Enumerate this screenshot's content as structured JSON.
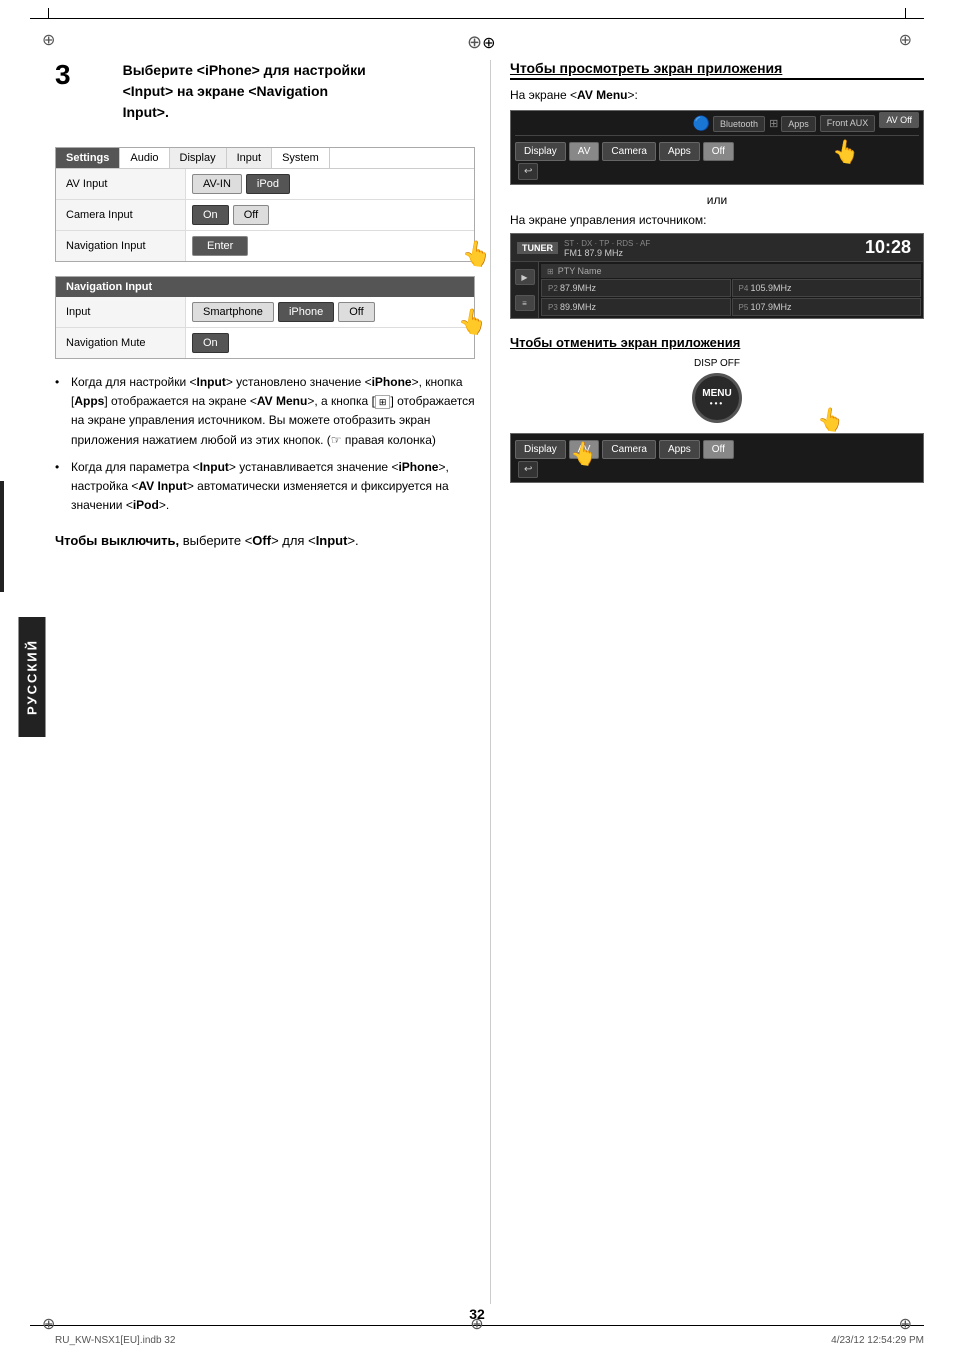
{
  "page": {
    "number": "32",
    "footer_file": "RU_KW-NSX1[EU].indb  32",
    "footer_date": "4/23/12   12:54:29 PM"
  },
  "sidebar": {
    "label": "РУССКИЙ"
  },
  "step3": {
    "number": "3",
    "text_line1": "Выберите <iPhone> для настройки",
    "text_line2": "<Input> на экране <Navigation",
    "text_line3": "Input>.",
    "settings_table": {
      "header": [
        "Settings",
        "Audio",
        "Display",
        "Input",
        "System"
      ],
      "rows": [
        {
          "label": "AV Input",
          "values": [
            "AV-IN",
            "iPod"
          ]
        },
        {
          "label": "Camera Input",
          "values": [
            "On",
            "Off"
          ]
        },
        {
          "label": "Navigation Input",
          "values": [
            "Enter"
          ]
        }
      ]
    },
    "nav_input_table": {
      "header": "Navigation Input",
      "rows": [
        {
          "label": "Input",
          "values": [
            "Smartphone",
            "iPhone",
            "Off"
          ]
        },
        {
          "label": "Navigation Mute",
          "values": [
            "On"
          ]
        }
      ]
    },
    "bullets": [
      "Когда для настройки <Input> установлено значение <iPhone>, кнопка [Apps] отображается на экране <AV Menu>, а кнопка [   ] отображается на экране управления источником. Вы можете отобразить экран приложения нажатием любой из этих кнопок. (☞ правая колонка)",
      "Когда для параметра <Input> устанавливается значение <iPhone>, настройка <AV Input> автоматически изменяется и фиксируется на значении <iPod>."
    ],
    "off_text": "Чтобы выключить, выберите <Off> для <Input>."
  },
  "right_col": {
    "view_section": {
      "title": "Чтобы просмотреть экран приложения",
      "subtitle": "На экране <AV Menu>:",
      "av_menu": {
        "top_buttons": [
          "Bluetooth",
          "Apps",
          "Front AUX",
          "AV Off"
        ],
        "bottom_buttons": [
          "Display",
          "AV",
          "Camera",
          "Apps",
          "Off"
        ]
      },
      "or_text": "или",
      "source_text": "На экране управления источником:",
      "tuner": {
        "label": "TUNER",
        "freq_info": "FM1  87.9 MHz",
        "time": "10:28",
        "pty_name": "PTY Name",
        "stations": [
          {
            "preset": "P2",
            "freq": "87.9MHz"
          },
          {
            "preset": "P4",
            "freq": "105.9MHz"
          },
          {
            "preset": "P3",
            "freq": "89.9MHz"
          },
          {
            "preset": "P5",
            "freq": "107.9MHz"
          }
        ]
      }
    },
    "cancel_section": {
      "title": "Чтобы отменить экран приложения",
      "disp_off": "DISP OFF",
      "menu_label": "MENU",
      "dots": "•••",
      "av_menu": {
        "buttons": [
          "Display",
          "AV",
          "Camera",
          "Apps",
          "Off"
        ]
      }
    }
  }
}
